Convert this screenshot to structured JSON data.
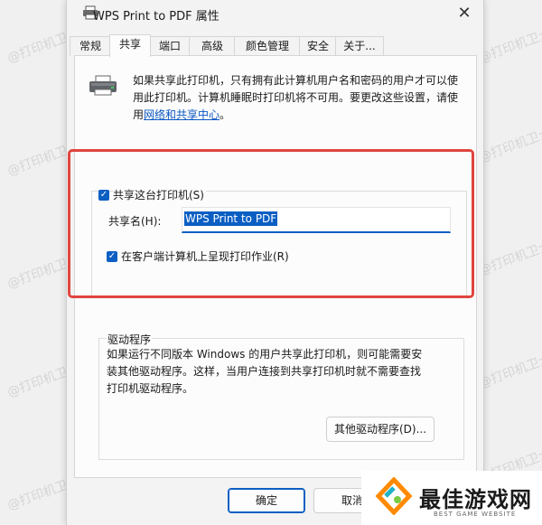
{
  "window": {
    "title": "WPS Print to PDF 属性",
    "close_glyph": "✕"
  },
  "tabs": [
    "常规",
    "共享",
    "端口",
    "高级",
    "颜色管理",
    "安全",
    "关于..."
  ],
  "active_tab": "共享",
  "description": {
    "line1": "如果共享此打印机，只有拥有此计算机用户名和密码的用户才可以使",
    "line2": "用此打印机。计算机睡眠时打印机将不可用。要更改这些设置，请使",
    "line3_prefix": "用",
    "link": "网络和共享中心",
    "line3_suffix": "。"
  },
  "share": {
    "share_printer_label": "共享这台打印机(S)",
    "share_printer_checked": true,
    "share_name_label": "共享名(H):",
    "share_name_value": "WPS Print to PDF",
    "render_jobs_label": "在客户端计算机上呈现打印作业(R)",
    "render_jobs_checked": true
  },
  "drivers": {
    "legend": "驱动程序",
    "line1": "如果运行不同版本 Windows 的用户共享此打印机，则可能需要安",
    "line2": "装其他驱动程序。这样，当用户连接到共享打印机时就不需要查找",
    "line3": "打印机驱动程序。",
    "button": "其他驱动程序(D)..."
  },
  "footer": {
    "ok": "确定",
    "cancel": "取消"
  },
  "watermark_text": "@打印机卫士",
  "logo": {
    "name": "最佳游戏网",
    "sub": "BEST GAME WEBSITE"
  },
  "colors": {
    "accent": "#0b5fc3",
    "highlight_frame": "#e0453f",
    "link": "#0b58c2"
  }
}
